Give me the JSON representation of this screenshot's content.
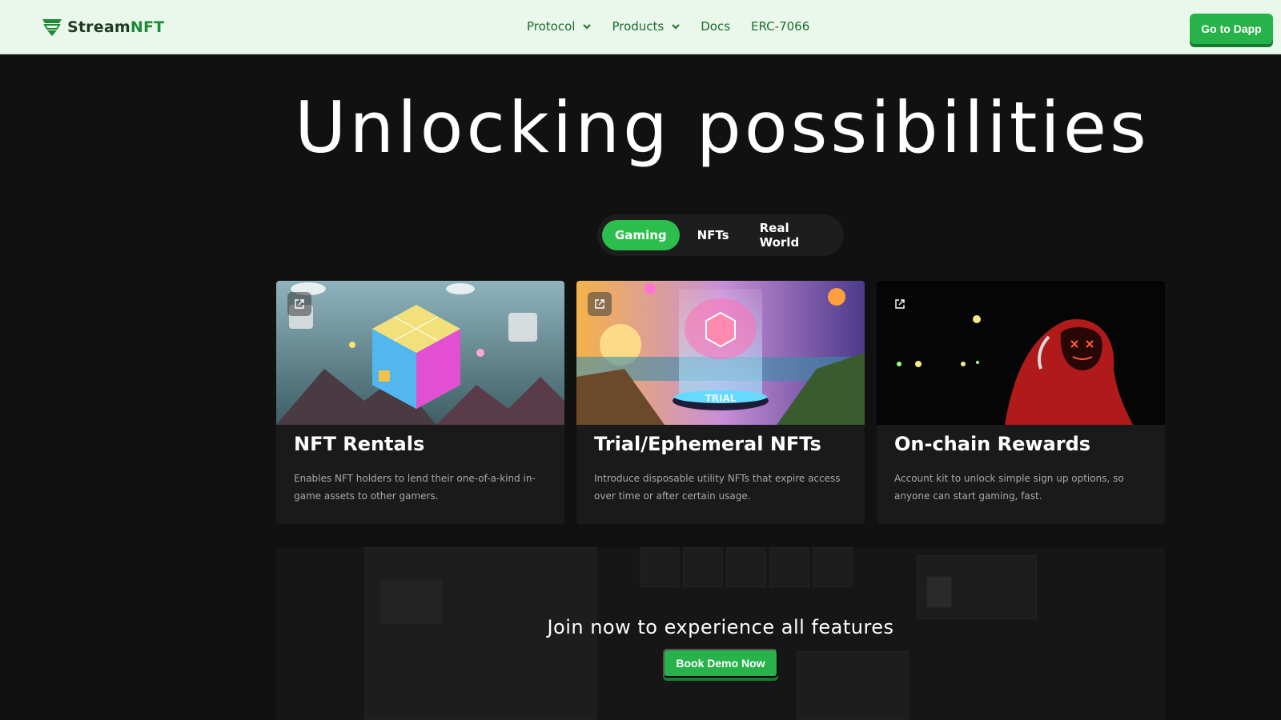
{
  "brand": {
    "name_prefix": "Stream",
    "name_suffix": "NFT"
  },
  "nav": {
    "items": [
      {
        "label": "Protocol",
        "has_dropdown": true
      },
      {
        "label": "Products",
        "has_dropdown": true
      },
      {
        "label": "Docs",
        "has_dropdown": false
      },
      {
        "label": "ERC-7066",
        "has_dropdown": false
      }
    ],
    "cta": "Go to Dapp"
  },
  "hero": {
    "title": "Unlocking possibilities"
  },
  "tabs": {
    "items": [
      "Gaming",
      "NFTs",
      "Real World"
    ],
    "active": "Gaming"
  },
  "cards": [
    {
      "title": "NFT Rentals",
      "description": "Enables NFT holders to lend their one-of-a-kind in-game assets to other gamers.",
      "image": "isometric-cube-art",
      "badge": ""
    },
    {
      "title": "Trial/Ephemeral NFTs",
      "description": "Introduce disposable utility NFTs that expire access over time or after certain usage.",
      "image": "trial-portal-art",
      "badge": "TRIAL"
    },
    {
      "title": "On-chain Rewards",
      "description": "Account kit to unlock simple sign up options, so anyone can start gaming, fast.",
      "image": "hooded-gamer-art",
      "badge": ""
    }
  ],
  "cta_section": {
    "text": "Join now to experience all features",
    "button": "Book Demo Now"
  },
  "colors": {
    "accent": "#27b24a",
    "nav_bg": "#e9f8ea",
    "page_bg": "#111111",
    "card_bg": "#1a1a1a"
  }
}
